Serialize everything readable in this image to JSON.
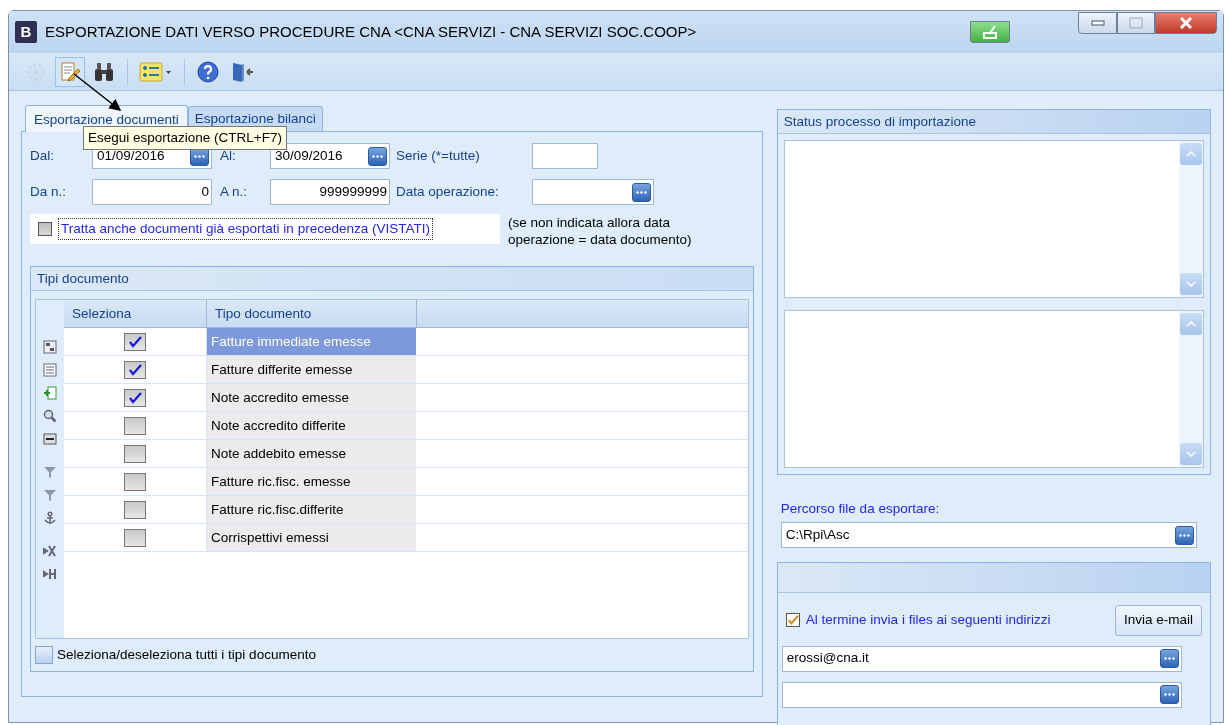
{
  "window": {
    "logo": "B",
    "title": "ESPORTAZIONE DATI VERSO PROCEDURE CNA <CNA SERVIZI - CNA SERVIZI SOC.COOP>"
  },
  "toolbar": [
    {
      "kind": "gear",
      "disabled": true,
      "hovered": false
    },
    {
      "kind": "edit",
      "disabled": false,
      "hovered": true
    },
    {
      "kind": "binoculars",
      "disabled": false,
      "hovered": false
    },
    {
      "kind": "list",
      "disabled": false,
      "hovered": false
    },
    {
      "kind": "help",
      "disabled": false,
      "hovered": false
    },
    {
      "kind": "exit",
      "disabled": false,
      "hovered": false
    }
  ],
  "tabs": [
    {
      "label": "Esportazione documenti",
      "selected": true
    },
    {
      "label": "Esportazione bilanci",
      "selected": false
    }
  ],
  "tooltip": {
    "text": "Esegui esportazione (CTRL+F7)"
  },
  "filters": [
    [
      {
        "label": "Dal:",
        "value": "01/09/2016",
        "kind": "date"
      },
      {
        "label": "Al:",
        "value": "30/09/2016",
        "kind": "date"
      },
      {
        "label": "Serie (*=tutte)",
        "kind": "short"
      }
    ],
    [
      {
        "label": "Da n.:",
        "value": "0",
        "kind": "number"
      },
      {
        "label": "A n.:",
        "value": "999999999",
        "kind": "number"
      },
      {
        "label": "Data operazione:",
        "kind": "date"
      }
    ]
  ],
  "reprocess": {
    "label": "Tratta anche documenti già esportati in precedenza (VISTATI)",
    "checked": false
  },
  "note": "(se non indicata allora data operazione = data documento)",
  "doc_types": {
    "title": "Tipi documento",
    "columns": [
      "Seleziona",
      "Tipo documento"
    ],
    "rows": [
      {
        "label": "Fatture immediate emesse",
        "checked": true,
        "selected": true
      },
      {
        "label": "Fatture differite emesse",
        "checked": true,
        "selected": false
      },
      {
        "label": "Note accredito emesse",
        "checked": true,
        "selected": false
      },
      {
        "label": "Note accredito differite",
        "checked": false,
        "selected": false
      },
      {
        "label": "Note addebito emesse",
        "checked": false,
        "selected": false
      },
      {
        "label": "Fatture ric.fisc. emesse",
        "checked": false,
        "selected": false
      },
      {
        "label": "Fatture ric.fisc.differite",
        "checked": false,
        "selected": false
      },
      {
        "label": "Corrispettivi emessi",
        "checked": false,
        "selected": false
      }
    ],
    "select_all": {
      "label": "Seleziona/deseleziona tutti i tipi documento",
      "checked": false
    }
  },
  "status": {
    "title": "Status processo di importazione"
  },
  "export_path": {
    "label": "Percorso file da esportare:",
    "value": "C:\\Rpi\\Asc"
  },
  "email": {
    "send": {
      "label": "Al termine invia i files ai seguenti indirizzi",
      "checked": true
    },
    "button": "Invia e-mail",
    "addresses": [
      {
        "kind": "field",
        "value": "erossi@cna.it"
      },
      {
        "kind": "field"
      }
    ]
  }
}
